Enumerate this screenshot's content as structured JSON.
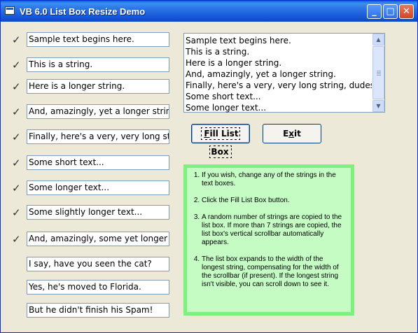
{
  "window": {
    "title": "VB 6.0 List Box Resize Demo"
  },
  "title_buttons": {
    "minimize": "_",
    "maximize": "□",
    "close": "✕"
  },
  "icons": {
    "check": "✓",
    "scroll_up": "▲",
    "scroll_down": "▼"
  },
  "rows": [
    {
      "checked": true,
      "text": "Sample text begins here."
    },
    {
      "checked": true,
      "text": "This is a string."
    },
    {
      "checked": true,
      "text": "Here is a longer string."
    },
    {
      "checked": true,
      "text": "And, amazingly, yet a longer string."
    },
    {
      "checked": true,
      "text": "Finally, here's a very, very long string, dudes!!"
    },
    {
      "checked": true,
      "text": "Some short text..."
    },
    {
      "checked": true,
      "text": "Some longer text..."
    },
    {
      "checked": true,
      "text": "Some slightly longer text..."
    },
    {
      "checked": true,
      "text": "And, amazingly, some yet longer text"
    },
    {
      "checked": false,
      "text": "I say, have you seen the cat?"
    },
    {
      "checked": false,
      "text": "Yes, he's moved to Florida."
    },
    {
      "checked": false,
      "text": "But he didn't finish his Spam!"
    }
  ],
  "listbox": {
    "items": [
      "Sample text begins here.",
      "This is a string.",
      "Here is a longer string.",
      "And, amazingly, yet a longer string.",
      "Finally, here's a very, very long string, dudes!!",
      "Some short text...",
      "Some longer text..."
    ]
  },
  "buttons": {
    "fill_pre": "",
    "fill_accel": "F",
    "fill_post": "ill List Box",
    "exit_pre": "E",
    "exit_accel": "x",
    "exit_post": "it"
  },
  "instructions": [
    "If you wish, change any of the strings in the text boxes.",
    "Click the Fill List Box button.",
    "A random number of strings are copied to the list box. If more than 7 strings are copied, the list box's vertical scrollbar automatically appears.",
    "The list box expands to the width of the longest string, compensating for the width of the scrollbar (if present). If the longest string isn't visible, you can scroll down to see it."
  ],
  "colors": {
    "title_bar": "#2a72e6",
    "info_bg": "#c4fcc4",
    "info_border": "#7cf17c"
  }
}
